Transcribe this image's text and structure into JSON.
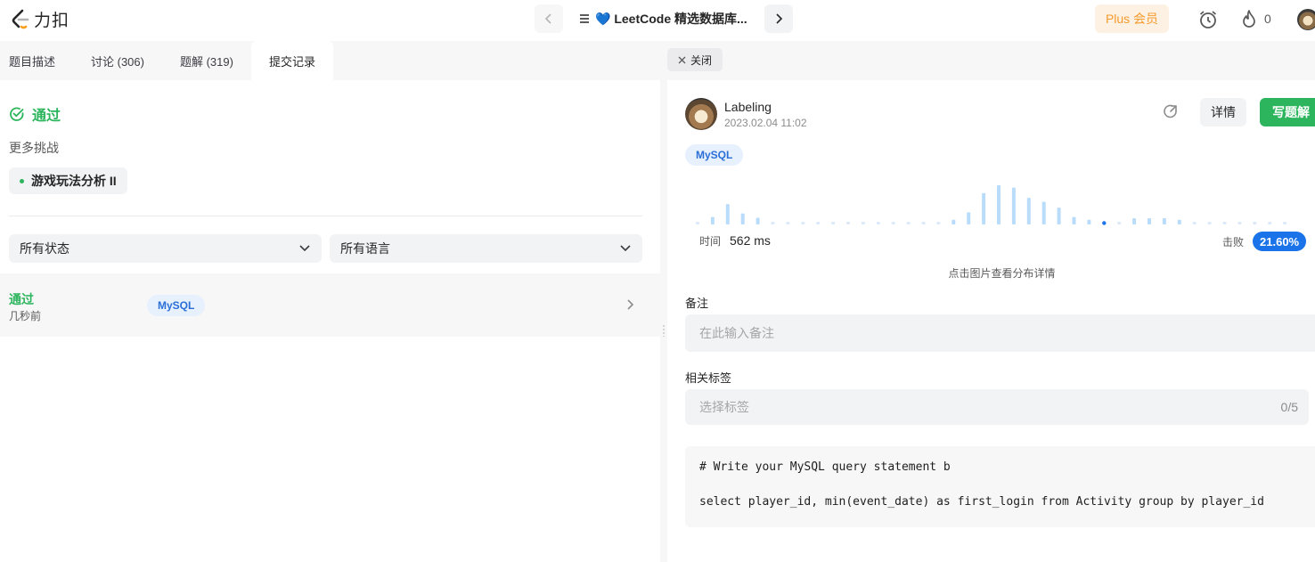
{
  "brand": {
    "name": "力扣"
  },
  "nav": {
    "problem_list": "💙 LeetCode 精选数据库..."
  },
  "header": {
    "plus_label": "Plus 会员",
    "streak": "0"
  },
  "left_tabs": [
    {
      "label": "题目描述"
    },
    {
      "label": "讨论 (306)"
    },
    {
      "label": "题解 (319)"
    },
    {
      "label": "提交记录"
    }
  ],
  "result": {
    "status": "通过",
    "more_challenges": "更多挑战",
    "challenge_item": "游戏玩法分析 II"
  },
  "filters": {
    "status": "所有状态",
    "language": "所有语言"
  },
  "submission": {
    "status": "通过",
    "time": "几秒前",
    "language": "MySQL"
  },
  "right_tab": {
    "close_label": "关闭"
  },
  "detail": {
    "user": "Labeling",
    "submitted_at": "2023.02.04 11:02",
    "language": "MySQL",
    "detail_button": "详情",
    "write_solution_button": "写题解",
    "runtime_label": "时间",
    "runtime_value": "562 ms",
    "beats_label": "击败",
    "beats_value": "21.60%",
    "chart_hint": "点击图片查看分布详情",
    "note_label": "备注",
    "note_placeholder": "在此输入备注",
    "tags_label": "相关标签",
    "tags_placeholder": "选择标签",
    "tags_count": "0/5"
  },
  "code": {
    "lines": [
      "# Write your MySQL query statement b",
      "",
      "select player_id, min(event_date) as first_login from Activity group by player_id"
    ]
  },
  "distribution": {
    "bar_levels": [
      0.05,
      0.19,
      0.52,
      0.28,
      0.17,
      0.05,
      0.05,
      0.05,
      0.05,
      0.05,
      0.05,
      0.05,
      0.05,
      0.05,
      0.05,
      0.05,
      0.05,
      0.12,
      0.31,
      0.8,
      1.0,
      0.94,
      0.68,
      0.58,
      0.43,
      0.19,
      0.12,
      0.05,
      0.05,
      0.16,
      0.16,
      0.16,
      0.12,
      0.05,
      0.05,
      0.05,
      0.05,
      0.05,
      0.05,
      0.05
    ],
    "highlight_index": 27,
    "colors": {
      "bar": "#b9dcfb",
      "dot": "#dbe9f8",
      "highlight": "#1a73e8"
    }
  },
  "colors": {
    "accent_green": "#2db55d",
    "accent_blue": "#1a73e8",
    "plus_orange": "#f59b2e"
  }
}
